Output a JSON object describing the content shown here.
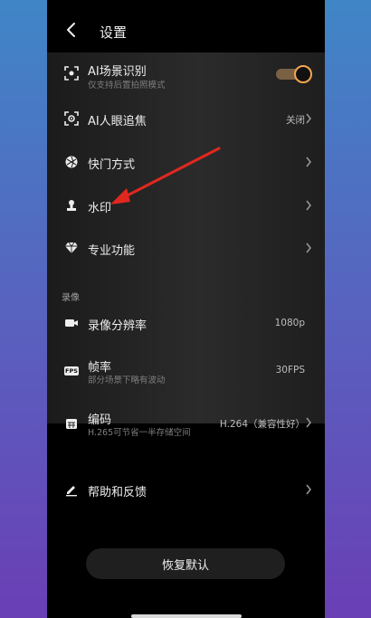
{
  "header": {
    "title": "设置"
  },
  "rows": [
    {
      "label": "AI场景识别",
      "sub": "仅支持后置拍照模式",
      "toggle_on": true,
      "icon": "scene-recognition-icon"
    },
    {
      "label": "AI人眼追焦",
      "value": "关闭",
      "icon": "eye-focus-icon"
    },
    {
      "label": "快门方式",
      "icon": "shutter-icon"
    },
    {
      "label": "水印",
      "icon": "watermark-icon"
    },
    {
      "label": "专业功能",
      "icon": "diamond-icon"
    }
  ],
  "video_section": {
    "title": "录像"
  },
  "video_rows": [
    {
      "label": "录像分辨率",
      "value": "1080p",
      "icon": "video-camera-icon"
    },
    {
      "label": "帧率",
      "sub": "部分场景下略有波动",
      "value": "30FPS",
      "icon_text": "FPS",
      "icon": "fps-icon"
    },
    {
      "label": "编码",
      "sub": "H.265可节省一半存储空间",
      "value": "H.264（兼容性好）",
      "icon": "codec-icon"
    }
  ],
  "help": {
    "label": "帮助和反馈",
    "icon": "edit-icon"
  },
  "reset_button": {
    "label": "恢复默认"
  },
  "colors": {
    "accent": "#f4a74f",
    "arrow": "#e0281f"
  }
}
